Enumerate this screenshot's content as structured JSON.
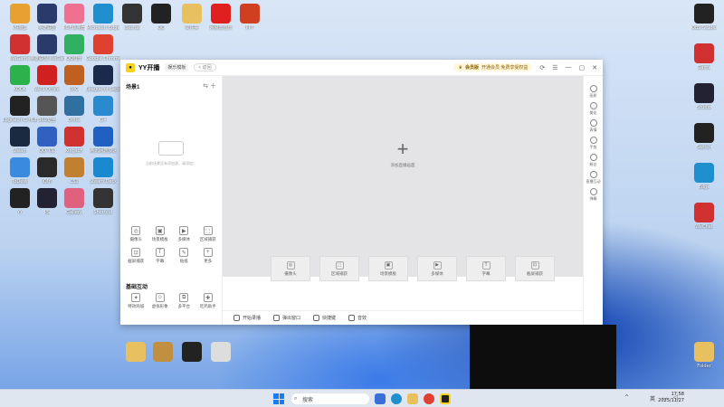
{
  "desktop": {
    "icons": [
      {
        "label": "VR摄像",
        "color": "#e8a030"
      },
      {
        "label": "英雄联盟",
        "color": "#2a3a6a"
      },
      {
        "label": "PDF转换器",
        "color": "#f07090"
      },
      {
        "label": "Microsoft Edge",
        "color": "#1f8fd0"
      },
      {
        "label": "Wechat",
        "color": "#333"
      },
      {
        "label": "QQ",
        "color": "#222"
      },
      {
        "label": "文件夹",
        "color": "#e8c060"
      },
      {
        "label": "网易云音乐",
        "color": "#e02020"
      },
      {
        "label": "PPT",
        "color": "#d04020"
      },
      {
        "label": "WeGame",
        "color": "#d03030"
      },
      {
        "label": "英雄联盟 WeGame",
        "color": "#2a3a6a"
      },
      {
        "label": "QQ音乐",
        "color": "#30b060"
      },
      {
        "label": "Google Chrome",
        "color": "#e04030"
      },
      {
        "label": "KOOK",
        "color": "#2bb24c"
      },
      {
        "label": "WPS Office",
        "color": "#d02020"
      },
      {
        "label": "IMG",
        "color": "#c06020"
      },
      {
        "label": "League of Legends",
        "color": "#1a2a4a"
      },
      {
        "label": "Logitech G HUB",
        "color": "#222"
      },
      {
        "label": "360安全",
        "color": "#555"
      },
      {
        "label": "Office",
        "color": "#3070a0"
      },
      {
        "label": "G+",
        "color": "#2a8ad0"
      },
      {
        "label": "Steam",
        "color": "#1a2a40"
      },
      {
        "label": "QQ飞车",
        "color": "#3060c0"
      },
      {
        "label": "Kingsoft",
        "color": "#d03030"
      },
      {
        "label": "腾讯网游加速",
        "color": "#2060c0"
      },
      {
        "label": "ToDesk",
        "color": "#3a8ae0"
      },
      {
        "label": "iQIYI",
        "color": "#2a2a2a"
      },
      {
        "label": "CS2",
        "color": "#c08030"
      },
      {
        "label": "Steam Deck",
        "color": "#1a8ad0"
      },
      {
        "label": "YY",
        "color": "#222"
      },
      {
        "label": "PS",
        "color": "#223"
      },
      {
        "label": "Gallery",
        "color": "#e06080"
      },
      {
        "label": "Shortcut",
        "color": "#333"
      }
    ],
    "right_icons": [
      {
        "label": "OBS Studio",
        "color": "#222"
      },
      {
        "label": "Game",
        "color": "#d03030"
      },
      {
        "label": "Studio",
        "color": "#223"
      },
      {
        "label": "Switch",
        "color": "#222"
      },
      {
        "label": "Edge",
        "color": "#1f8fd0"
      },
      {
        "label": "WeChat",
        "color": "#d03030"
      },
      {
        "label": "Folder",
        "color": "#e8c060"
      }
    ]
  },
  "app": {
    "title": "YY开播",
    "tag": "娱乐模板",
    "back_label": "< 返回",
    "vip_label": "会员版",
    "vip_tip": "开通会员 免费享受权益",
    "window_buttons": [
      "⟳",
      "☰",
      "—",
      "▢",
      "✕"
    ],
    "scene_name": "场景1",
    "empty_tip": "当前场景没有添加源，请添加！",
    "sources": [
      {
        "label": "摄像头",
        "glyph": "◎"
      },
      {
        "label": "场景模板",
        "glyph": "▣"
      },
      {
        "label": "多媒体",
        "glyph": "▶"
      },
      {
        "label": "区域捕获",
        "glyph": "⬚"
      },
      {
        "label": "截屏捕获",
        "glyph": "⊡"
      },
      {
        "label": "字幕",
        "glyph": "T"
      },
      {
        "label": "贴纸",
        "glyph": "✎"
      },
      {
        "label": "更多",
        "glyph": "+"
      }
    ],
    "interaction_title": "基础互动",
    "interactions": [
      {
        "label": "特效商城",
        "glyph": "✦"
      },
      {
        "label": "虚拟形象",
        "glyph": "☺"
      },
      {
        "label": "多平台",
        "glyph": "⧉"
      },
      {
        "label": "吃鸡助手",
        "glyph": "✚"
      }
    ],
    "preview_add_label": "添加直播画面",
    "preview_sources": [
      {
        "label": "摄像头",
        "glyph": "◎"
      },
      {
        "label": "区域捕获",
        "glyph": "⬚"
      },
      {
        "label": "场景模板",
        "glyph": "▣"
      },
      {
        "label": "多媒体",
        "glyph": "▶"
      },
      {
        "label": "字幕",
        "glyph": "T"
      },
      {
        "label": "截屏捕获",
        "glyph": "⊡"
      }
    ],
    "bottom_bar": [
      "开始录播",
      "弹出窗口",
      "快捷键",
      "音效"
    ],
    "right_tools": [
      "画质",
      "美化",
      "表情",
      "手势",
      "粉丝",
      "直播互动",
      "弹幕"
    ]
  },
  "taskbar": {
    "search_placeholder": "搜索",
    "time": "17:58",
    "date": "2025/11/27",
    "lang": "英"
  }
}
